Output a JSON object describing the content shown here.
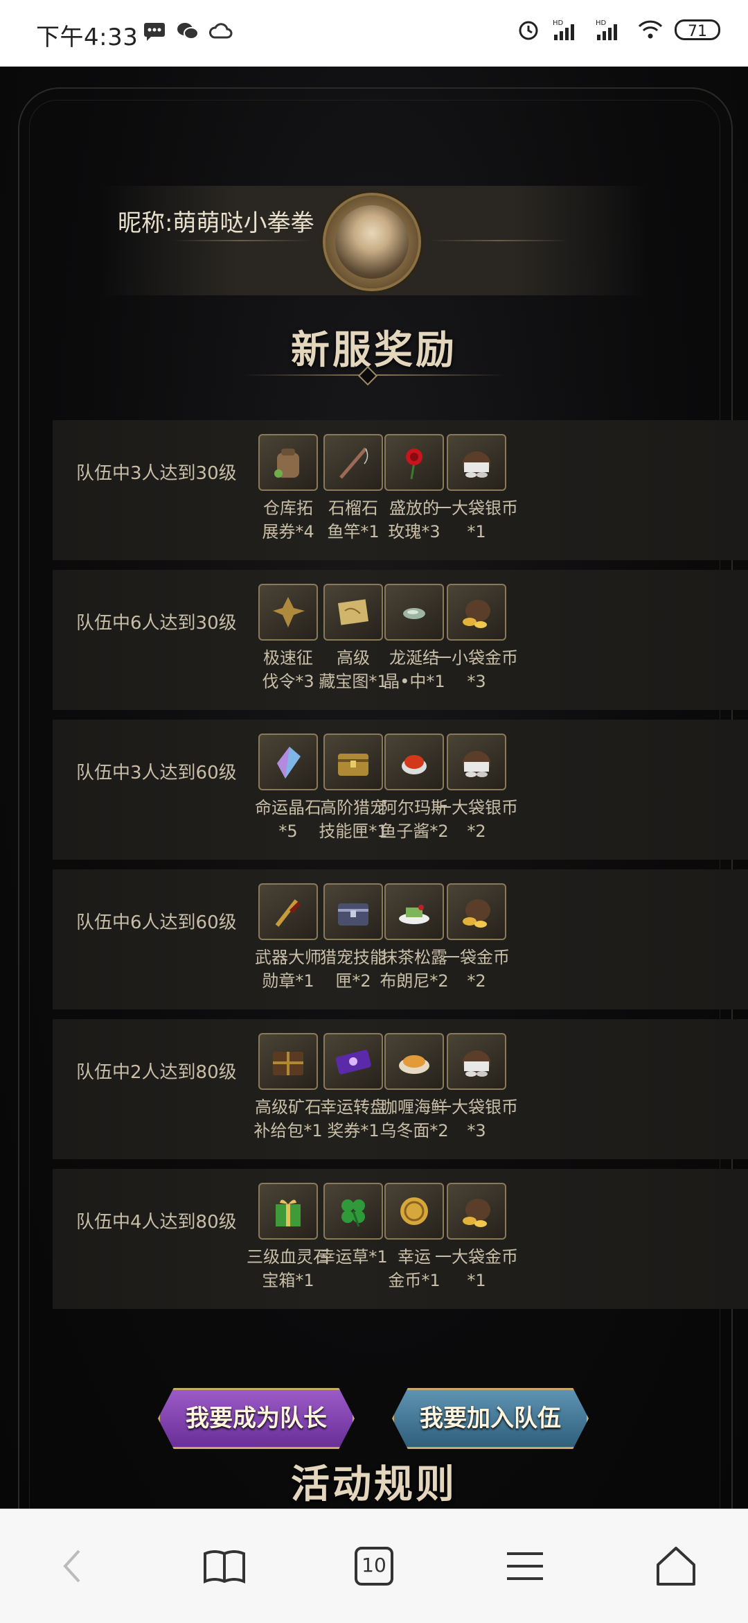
{
  "status_bar": {
    "time": "下午4:33",
    "battery": "71",
    "signal_1": "HD",
    "signal_2": "HD"
  },
  "profile": {
    "nickname": "昵称:萌萌哒小拳拳"
  },
  "section_titles": {
    "rewards": "新服奖励",
    "rules": "活动规则"
  },
  "rewards": [
    {
      "condition": "队伍中3人达到30级",
      "items": [
        {
          "name": "仓库拓展券*4",
          "lines": [
            "仓库拓",
            "展券*4"
          ],
          "icon": "backpack-icon"
        },
        {
          "name": "石榴石鱼竿*1",
          "lines": [
            "石榴石",
            "鱼竿*1"
          ],
          "icon": "fishing-rod-icon"
        },
        {
          "name": "盛放的玫瑰*3",
          "lines": [
            "盛放的",
            "玫瑰*3"
          ],
          "icon": "rose-icon"
        },
        {
          "name": "一大袋银币*1",
          "lines": [
            "一大袋银币",
            "*1"
          ],
          "icon": "silver-bag-icon"
        }
      ]
    },
    {
      "condition": "队伍中6人达到30级",
      "items": [
        {
          "name": "极速征伐令*3",
          "lines": [
            "极速征",
            "伐令*3"
          ],
          "icon": "emblem-icon"
        },
        {
          "name": "高级藏宝图*1",
          "lines": [
            "高级",
            "藏宝图*1"
          ],
          "icon": "treasure-map-icon"
        },
        {
          "name": "龙涎结晶•中*1",
          "lines": [
            "龙涎结",
            "晶•中*1"
          ],
          "icon": "crystal-stone-icon"
        },
        {
          "name": "一小袋金币*3",
          "lines": [
            "一小袋金币",
            "*3"
          ],
          "icon": "gold-bag-icon"
        }
      ]
    },
    {
      "condition": "队伍中3人达到60级",
      "items": [
        {
          "name": "命运晶石*5",
          "lines": [
            "命运晶石",
            "*5"
          ],
          "icon": "gem-icon"
        },
        {
          "name": "高阶猎宠技能匣*1",
          "lines": [
            "高阶猎宠",
            "技能匣*1"
          ],
          "icon": "gold-chest-icon"
        },
        {
          "name": "阿尔玛斯鱼子酱*2",
          "lines": [
            "阿尔玛斯",
            "鱼子酱*2"
          ],
          "icon": "caviar-icon"
        },
        {
          "name": "一大袋银币*2",
          "lines": [
            "一大袋银币",
            "*2"
          ],
          "icon": "silver-bag-icon"
        }
      ]
    },
    {
      "condition": "队伍中6人达到60级",
      "items": [
        {
          "name": "武器大师勋章*1",
          "lines": [
            "武器大师",
            "勋章*1"
          ],
          "icon": "medal-icon"
        },
        {
          "name": "猎宠技能匣*2",
          "lines": [
            "猎宠技能",
            "匣*2"
          ],
          "icon": "silver-chest-icon"
        },
        {
          "name": "抹茶松露布朗尼*2",
          "lines": [
            "抹茶松露",
            "布朗尼*2"
          ],
          "icon": "cake-icon"
        },
        {
          "name": "一袋金币*2",
          "lines": [
            "一袋金币",
            "*2"
          ],
          "icon": "gold-bag-icon"
        }
      ]
    },
    {
      "condition": "队伍中2人达到80级",
      "items": [
        {
          "name": "高级矿石补给包*1",
          "lines": [
            "高级矿石",
            "补给包*1"
          ],
          "icon": "ore-box-icon"
        },
        {
          "name": "幸运转盘奖券*1",
          "lines": [
            "幸运转盘",
            "奖券*1"
          ],
          "icon": "ticket-icon"
        },
        {
          "name": "咖喱海鲜乌冬面*2",
          "lines": [
            "咖喱海鲜",
            "乌冬面*2"
          ],
          "icon": "noodle-icon"
        },
        {
          "name": "一大袋银币*3",
          "lines": [
            "一大袋银币",
            "*3"
          ],
          "icon": "silver-bag-icon"
        }
      ]
    },
    {
      "condition": "队伍中4人达到80级",
      "items": [
        {
          "name": "三级血灵石宝箱*1",
          "lines": [
            "三级血灵石",
            "宝箱*1"
          ],
          "icon": "gift-box-icon"
        },
        {
          "name": "幸运草*1",
          "lines": [
            "幸运草*1",
            ""
          ],
          "icon": "clover-icon"
        },
        {
          "name": "幸运金币*1",
          "lines": [
            "幸运",
            "金币*1"
          ],
          "icon": "gold-coin-icon"
        },
        {
          "name": "一大袋金币*1",
          "lines": [
            "一大袋金币",
            "*1"
          ],
          "icon": "gold-bag-icon"
        }
      ]
    }
  ],
  "buttons": {
    "captain": "我要成为队长",
    "join": "我要加入队伍"
  },
  "browser_nav": {
    "tab_count": "10"
  },
  "colors": {
    "captain_button": "#7d3fb0",
    "join_button": "#3f7596",
    "title_gold": "#e3d6bd"
  }
}
